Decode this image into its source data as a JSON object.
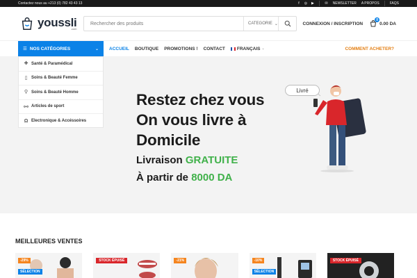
{
  "topbar": {
    "contact": "Contactez nous au +213 (0) 782 43 43 13",
    "newsletter": "NEWSLETTER",
    "about": "A PROPOS",
    "faqs": "FAQS"
  },
  "header": {
    "logo_name": "youssli",
    "logo_sub": ".com",
    "search_placeholder": "Rechercher des produits",
    "category_label": "CATEGORIE",
    "account": "CONNEXION / INSCRIPTION",
    "cart_count": "0",
    "cart_total": "0.00 DA"
  },
  "nav": {
    "categories_button": "NOS CATÉGORIES",
    "items": [
      "ACCUEIL",
      "BOUTIQUE",
      "PROMOTIONS !",
      "CONTACT"
    ],
    "language": "FRANÇAIS",
    "how_to_buy": "COMMENT ACHETER?"
  },
  "categories": [
    {
      "label": "Santé & Paramédical",
      "icon": "health-icon"
    },
    {
      "label": "Soins & Beauté Femme",
      "icon": "bottle-icon"
    },
    {
      "label": "Soins & Beauté Homme",
      "icon": "razor-icon"
    },
    {
      "label": "Articles de sport",
      "icon": "dumbbell-icon"
    },
    {
      "label": "Electronique & Accéssoires",
      "icon": "headphones-icon"
    }
  ],
  "hero": {
    "line1": "Restez chez vous",
    "line2": "On vous livre à",
    "line3": "Domicile",
    "line4_prefix": "Livraison",
    "line4_highlight": "GRATUITE",
    "line5_prefix": "À partir de",
    "line5_highlight": "8000 DA",
    "bubble": "Livré"
  },
  "section": {
    "title": "MEILLEURES VENTES"
  },
  "products": [
    {
      "discount": "-29%",
      "selection": "SÉLECTION",
      "out_of_stock": ""
    },
    {
      "discount": "",
      "selection": "",
      "out_of_stock": "STOCK ÉPUISÉ"
    },
    {
      "discount": "-21%",
      "selection": "",
      "out_of_stock": ""
    },
    {
      "discount": "-10%",
      "selection": "SÉLECTION",
      "out_of_stock": ""
    },
    {
      "discount": "",
      "selection": "",
      "out_of_stock": "STOCK ÉPUISÉ"
    }
  ],
  "colors": {
    "primary": "#0b82e7",
    "accent_orange": "#e37e12",
    "green": "#40b14a",
    "topbar": "#1a1a1a"
  }
}
